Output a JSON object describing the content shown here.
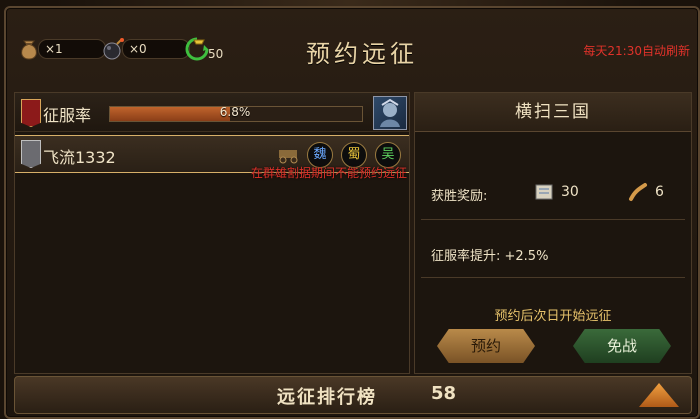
{
  "header": {
    "title": "预约远征",
    "refresh_text": "每天21:30自动刷新",
    "resources": [
      {
        "icon": "coin-bag-icon",
        "value": "×1"
      },
      {
        "icon": "bomb-icon",
        "value": "×0"
      },
      {
        "icon": "gold-ingot-refresh-icon",
        "value": "50"
      }
    ]
  },
  "left": {
    "rate_label": "征服率",
    "rate_value": "6.8%",
    "rate_fraction": 0.068,
    "player": {
      "name": "飞流1332",
      "factions": [
        "魏",
        "蜀",
        "吴"
      ]
    },
    "warning": "在群雄割据期间不能预约远征"
  },
  "right": {
    "title": "横扫三国",
    "reward_label": "获胜奖励:",
    "reward_scroll": "30",
    "reward_whip": "6",
    "rate_up": "征服率提升: +2.5%",
    "notice": "预约后次日开始远征",
    "reserve_btn": "预约",
    "exempt_btn": "免战"
  },
  "footer": {
    "label": "远征排行榜",
    "count": "58"
  },
  "colors": {
    "warning_red": "#e0322a",
    "notice_gold": "#e6c26b",
    "bar_fill": "#c0642c"
  }
}
